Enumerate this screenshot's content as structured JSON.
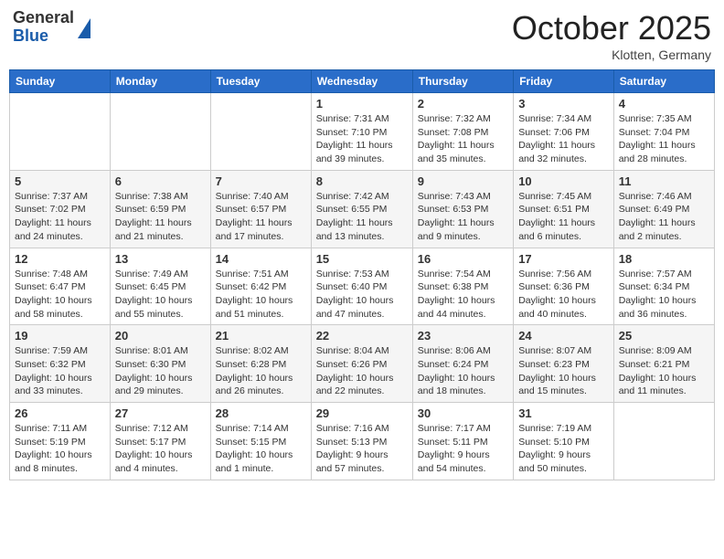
{
  "header": {
    "logo_general": "General",
    "logo_blue": "Blue",
    "month_title": "October 2025",
    "location": "Klotten, Germany"
  },
  "weekdays": [
    "Sunday",
    "Monday",
    "Tuesday",
    "Wednesday",
    "Thursday",
    "Friday",
    "Saturday"
  ],
  "weeks": [
    [
      {
        "day": "",
        "content": ""
      },
      {
        "day": "",
        "content": ""
      },
      {
        "day": "",
        "content": ""
      },
      {
        "day": "1",
        "content": "Sunrise: 7:31 AM\nSunset: 7:10 PM\nDaylight: 11 hours\nand 39 minutes."
      },
      {
        "day": "2",
        "content": "Sunrise: 7:32 AM\nSunset: 7:08 PM\nDaylight: 11 hours\nand 35 minutes."
      },
      {
        "day": "3",
        "content": "Sunrise: 7:34 AM\nSunset: 7:06 PM\nDaylight: 11 hours\nand 32 minutes."
      },
      {
        "day": "4",
        "content": "Sunrise: 7:35 AM\nSunset: 7:04 PM\nDaylight: 11 hours\nand 28 minutes."
      }
    ],
    [
      {
        "day": "5",
        "content": "Sunrise: 7:37 AM\nSunset: 7:02 PM\nDaylight: 11 hours\nand 24 minutes."
      },
      {
        "day": "6",
        "content": "Sunrise: 7:38 AM\nSunset: 6:59 PM\nDaylight: 11 hours\nand 21 minutes."
      },
      {
        "day": "7",
        "content": "Sunrise: 7:40 AM\nSunset: 6:57 PM\nDaylight: 11 hours\nand 17 minutes."
      },
      {
        "day": "8",
        "content": "Sunrise: 7:42 AM\nSunset: 6:55 PM\nDaylight: 11 hours\nand 13 minutes."
      },
      {
        "day": "9",
        "content": "Sunrise: 7:43 AM\nSunset: 6:53 PM\nDaylight: 11 hours\nand 9 minutes."
      },
      {
        "day": "10",
        "content": "Sunrise: 7:45 AM\nSunset: 6:51 PM\nDaylight: 11 hours\nand 6 minutes."
      },
      {
        "day": "11",
        "content": "Sunrise: 7:46 AM\nSunset: 6:49 PM\nDaylight: 11 hours\nand 2 minutes."
      }
    ],
    [
      {
        "day": "12",
        "content": "Sunrise: 7:48 AM\nSunset: 6:47 PM\nDaylight: 10 hours\nand 58 minutes."
      },
      {
        "day": "13",
        "content": "Sunrise: 7:49 AM\nSunset: 6:45 PM\nDaylight: 10 hours\nand 55 minutes."
      },
      {
        "day": "14",
        "content": "Sunrise: 7:51 AM\nSunset: 6:42 PM\nDaylight: 10 hours\nand 51 minutes."
      },
      {
        "day": "15",
        "content": "Sunrise: 7:53 AM\nSunset: 6:40 PM\nDaylight: 10 hours\nand 47 minutes."
      },
      {
        "day": "16",
        "content": "Sunrise: 7:54 AM\nSunset: 6:38 PM\nDaylight: 10 hours\nand 44 minutes."
      },
      {
        "day": "17",
        "content": "Sunrise: 7:56 AM\nSunset: 6:36 PM\nDaylight: 10 hours\nand 40 minutes."
      },
      {
        "day": "18",
        "content": "Sunrise: 7:57 AM\nSunset: 6:34 PM\nDaylight: 10 hours\nand 36 minutes."
      }
    ],
    [
      {
        "day": "19",
        "content": "Sunrise: 7:59 AM\nSunset: 6:32 PM\nDaylight: 10 hours\nand 33 minutes."
      },
      {
        "day": "20",
        "content": "Sunrise: 8:01 AM\nSunset: 6:30 PM\nDaylight: 10 hours\nand 29 minutes."
      },
      {
        "day": "21",
        "content": "Sunrise: 8:02 AM\nSunset: 6:28 PM\nDaylight: 10 hours\nand 26 minutes."
      },
      {
        "day": "22",
        "content": "Sunrise: 8:04 AM\nSunset: 6:26 PM\nDaylight: 10 hours\nand 22 minutes."
      },
      {
        "day": "23",
        "content": "Sunrise: 8:06 AM\nSunset: 6:24 PM\nDaylight: 10 hours\nand 18 minutes."
      },
      {
        "day": "24",
        "content": "Sunrise: 8:07 AM\nSunset: 6:23 PM\nDaylight: 10 hours\nand 15 minutes."
      },
      {
        "day": "25",
        "content": "Sunrise: 8:09 AM\nSunset: 6:21 PM\nDaylight: 10 hours\nand 11 minutes."
      }
    ],
    [
      {
        "day": "26",
        "content": "Sunrise: 7:11 AM\nSunset: 5:19 PM\nDaylight: 10 hours\nand 8 minutes."
      },
      {
        "day": "27",
        "content": "Sunrise: 7:12 AM\nSunset: 5:17 PM\nDaylight: 10 hours\nand 4 minutes."
      },
      {
        "day": "28",
        "content": "Sunrise: 7:14 AM\nSunset: 5:15 PM\nDaylight: 10 hours\nand 1 minute."
      },
      {
        "day": "29",
        "content": "Sunrise: 7:16 AM\nSunset: 5:13 PM\nDaylight: 9 hours\nand 57 minutes."
      },
      {
        "day": "30",
        "content": "Sunrise: 7:17 AM\nSunset: 5:11 PM\nDaylight: 9 hours\nand 54 minutes."
      },
      {
        "day": "31",
        "content": "Sunrise: 7:19 AM\nSunset: 5:10 PM\nDaylight: 9 hours\nand 50 minutes."
      },
      {
        "day": "",
        "content": ""
      }
    ]
  ]
}
